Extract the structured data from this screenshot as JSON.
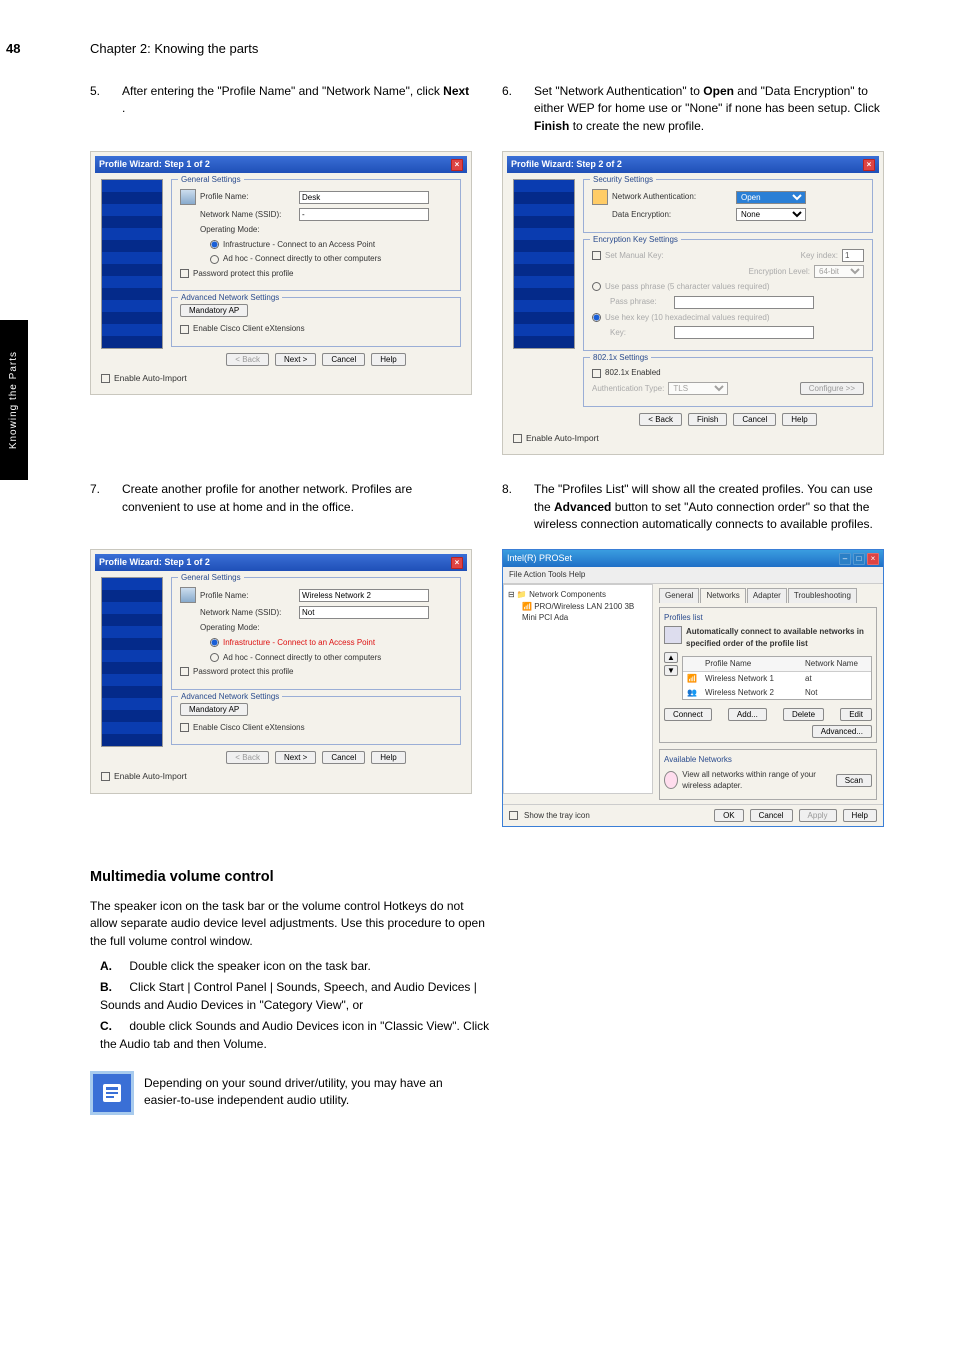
{
  "page": {
    "number": "48",
    "chapter_head": "Chapter 2: Knowing the parts"
  },
  "sidebar": {
    "label": "Knowing the Parts"
  },
  "intro_step5": {
    "num": "5.",
    "text_a": "After entering the \"Profile Name\" and \"Network Name\", click ",
    "next_bold": "Next",
    "text_b": "."
  },
  "intro_step6": {
    "num": "6.",
    "text_a": "Set \"Network Authentication\" to ",
    "open_bold": "Open",
    "text_b": " and \"Data Encryption\" to either WEP for home use or \"None\" if none has been setup. Click ",
    "finish_bold": "Finish",
    "text_c": " to create the new profile."
  },
  "wiz1a": {
    "title": "Profile Wizard: Step 1 of 2",
    "group_general": "General Settings",
    "profile_name_label": "Profile Name:",
    "profile_name_value": "Desk",
    "ssid_label": "Network Name (SSID):",
    "ssid_value": "-",
    "op_mode_label": "Operating Mode:",
    "op_infra": "Infrastructure - Connect to an Access Point",
    "op_adhoc": "Ad hoc - Connect directly to other computers",
    "pwd_protect": "Password protect this profile",
    "group_adv": "Advanced Network Settings",
    "mandatory_ap": "Mandatory AP",
    "cisco_ext": "Enable Cisco Client eXtensions",
    "btn_back": "< Back",
    "btn_next": "Next >",
    "btn_cancel": "Cancel",
    "btn_help": "Help",
    "auto_import": "Enable Auto-Import"
  },
  "wiz2": {
    "title": "Profile Wizard: Step 2 of 2",
    "group_sec": "Security Settings",
    "auth_label": "Network Authentication:",
    "auth_value": "Open",
    "enc_label": "Data Encryption:",
    "enc_value": "None",
    "group_key": "Encryption Key Settings",
    "set_manual": "Set Manual Key:",
    "key_index_lbl": "Key index:",
    "key_index_val": "1",
    "enc_level_lbl": "Encryption Level:",
    "enc_level_val": "64-bit",
    "use_pass_phrase": "Use pass phrase (5 character values required)",
    "pass_phrase_lbl": "Pass phrase:",
    "use_hex": "Use hex key (10 hexadecimal values required)",
    "key_lbl": "Key:",
    "group_8021x": "802.1x Settings",
    "enable_8021x": "802.1x Enabled",
    "auth_type_lbl": "Authentication Type:",
    "auth_type_val": "TLS",
    "configure": "Configure >>",
    "btn_back": "< Back",
    "btn_finish": "Finish",
    "btn_cancel": "Cancel",
    "btn_help": "Help",
    "auto_import": "Enable Auto-Import"
  },
  "step7": {
    "num": "7.",
    "text": "Create another profile for another network. Profiles are convenient to use at home and in the office."
  },
  "step8": {
    "num": "8.",
    "text_a": "The \"Profiles List\" will show all the created profiles. You can use the ",
    "adv_bold": "Advanced",
    "text_b": " button to set \"Auto connection order\" so that the wireless connection automatically connects to available profiles."
  },
  "wiz1b": {
    "title": "Profile Wizard: Step 1 of 2",
    "profile_name_value": "Wireless Network 2",
    "ssid_value": "Not"
  },
  "proset": {
    "title": "Intel(R) PROSet",
    "menu": "File  Action  Tools  Help",
    "tree_root": "Network Components",
    "tree_item": "PRO/Wireless LAN 2100 3B Mini PCI Ada",
    "tabs": [
      "General",
      "Networks",
      "Adapter",
      "Troubleshooting"
    ],
    "profiles_list_legend": "Profiles list",
    "auto_connect_text": "Automatically connect to available networks in specified order of the profile list",
    "col_profile": "Profile Name",
    "col_network": "Network Name",
    "rows": [
      {
        "profile": "Wireless Network 1",
        "network": "at"
      },
      {
        "profile": "Wireless Network 2",
        "network": "Not"
      }
    ],
    "btn_connect": "Connect",
    "btn_add": "Add...",
    "btn_delete": "Delete",
    "btn_edit": "Edit",
    "btn_advanced": "Advanced...",
    "avail_legend": "Available Networks",
    "avail_text": "View all networks within range of your wireless adapter.",
    "btn_scan": "Scan",
    "show_tray": "Show the tray icon",
    "btn_ok": "OK",
    "btn_cancel": "Cancel",
    "btn_apply": "Apply",
    "btn_help": "Help"
  },
  "section_volume": {
    "title": "Multimedia volume control",
    "para": "The speaker icon on the task bar or the volume control Hotkeys do not allow separate audio device level adjustments. Use this procedure to open the full volume control window.",
    "steps": [
      {
        "l": "A.",
        "t": "Double click the speaker icon on the task bar."
      },
      {
        "l": "B.",
        "t": "Click Start | Control Panel | Sounds, Speech, and Audio Devices | Sounds and Audio Devices in \"Category View\", or"
      },
      {
        "l": "C.",
        "t": "double click Sounds and Audio Devices icon in \"Classic View\". Click the Audio tab and then Volume."
      }
    ],
    "note": "Depending on your sound driver/utility, you may have an easier-to-use independent audio utility."
  }
}
